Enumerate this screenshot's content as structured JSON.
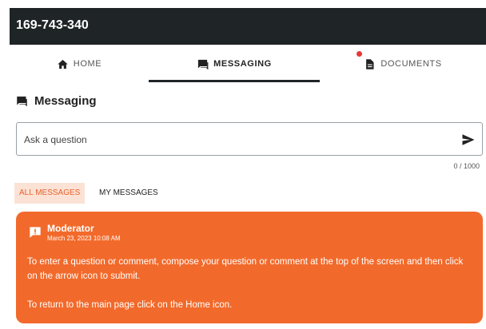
{
  "header": {
    "title": "169-743-340"
  },
  "nav": {
    "tabs": [
      {
        "label": "HOME",
        "icon": "home-icon",
        "active": false
      },
      {
        "label": "MESSAGING",
        "icon": "messaging-icon",
        "active": true
      },
      {
        "label": "DOCUMENTS",
        "icon": "document-icon",
        "active": false,
        "has_notification": true
      }
    ]
  },
  "section": {
    "title": "Messaging",
    "icon": "messaging-icon"
  },
  "compose": {
    "placeholder": "Ask a question",
    "value": "",
    "char_count": "0 / 1000",
    "send_icon": "send-icon"
  },
  "filters": [
    {
      "label": "ALL MESSAGES",
      "active": true
    },
    {
      "label": "MY MESSAGES",
      "active": false
    }
  ],
  "messages": [
    {
      "author": "Moderator",
      "timestamp": "March 23, 2023 10:08 AM",
      "icon": "alert-icon",
      "paragraphs": [
        "To enter a question or comment, compose your question or comment at the top of the screen and then click on the arrow icon to submit.",
        "To return to the main page click on the Home icon."
      ]
    }
  ],
  "colors": {
    "topbar": "#1f2527",
    "accent": "#f26a2b",
    "active_filter_bg": "#fbe2d5",
    "active_filter_text": "#e8622c",
    "notification": "#e53935"
  }
}
